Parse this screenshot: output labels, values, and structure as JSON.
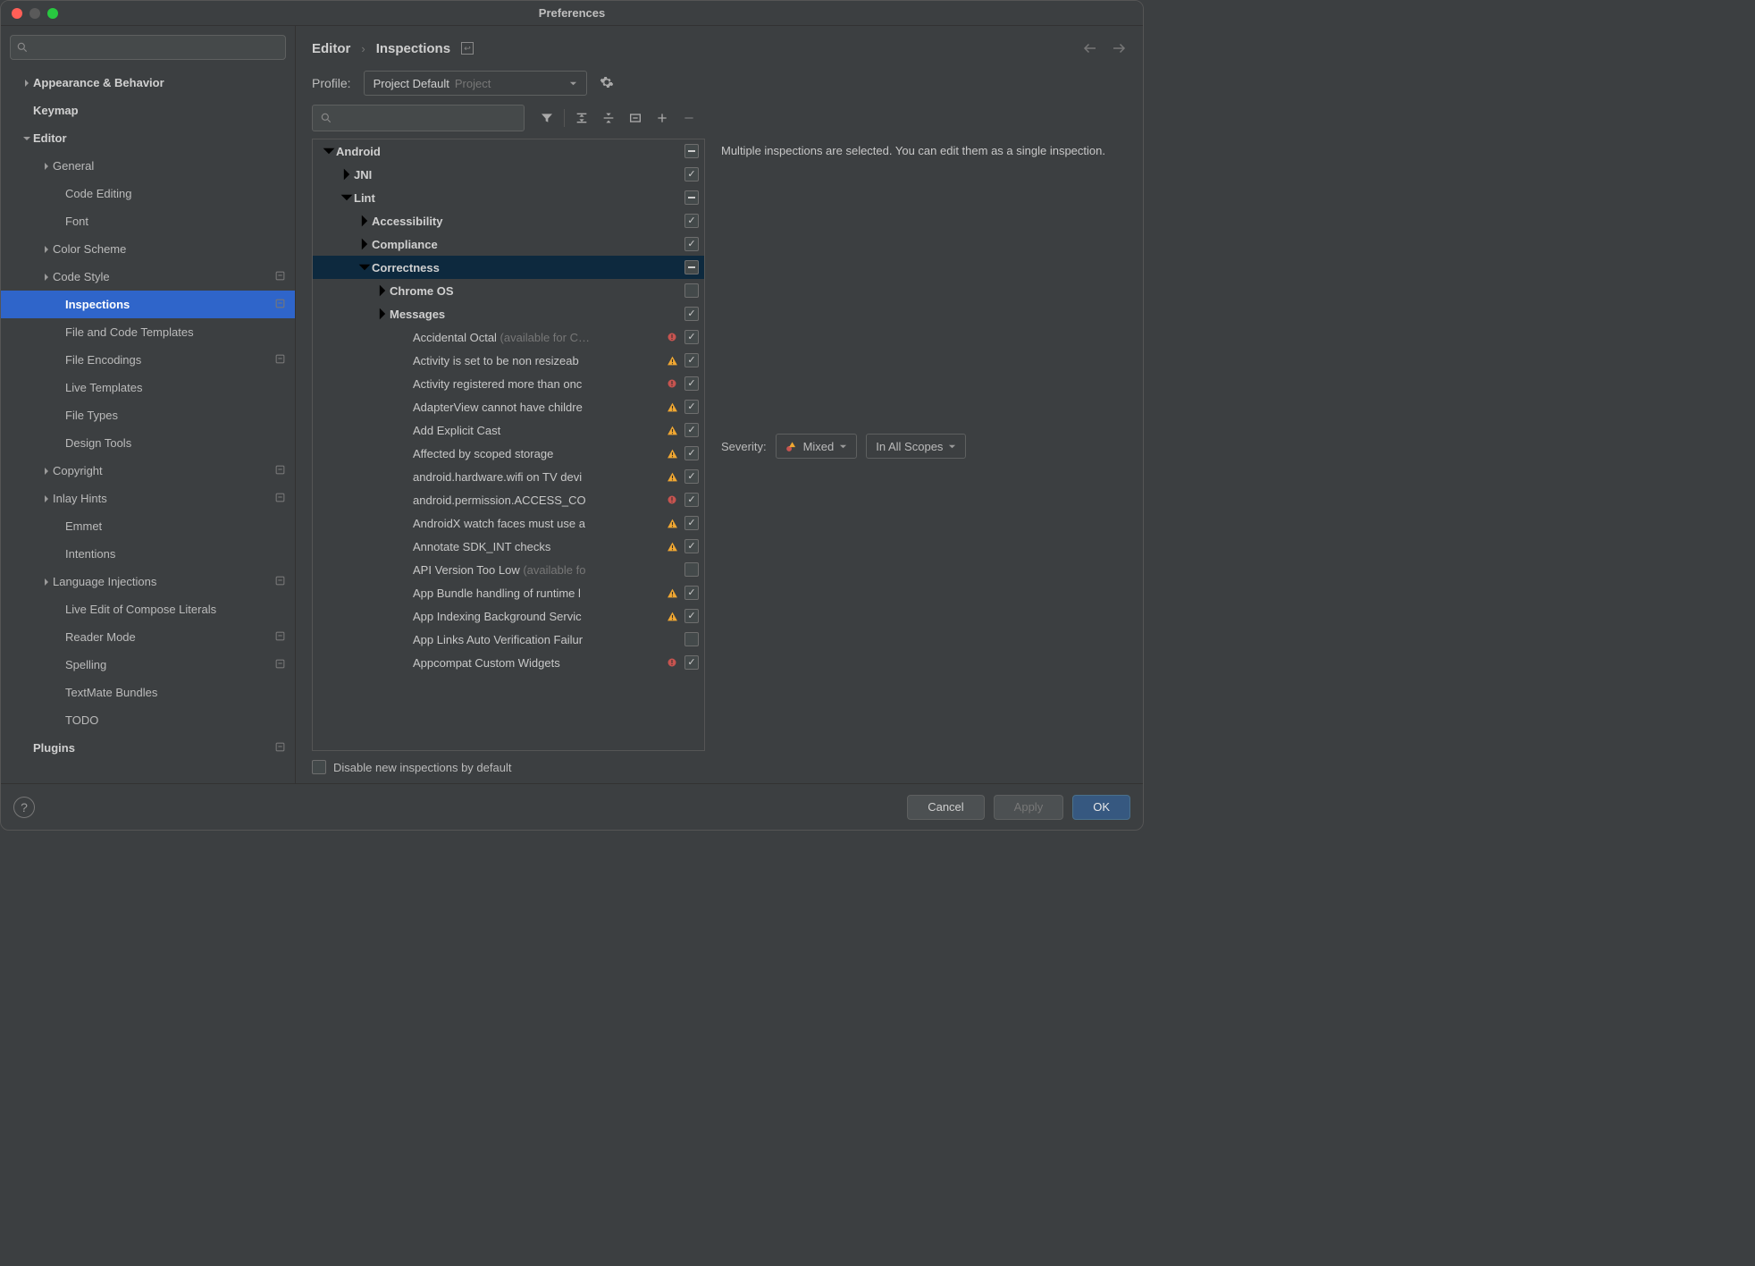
{
  "window_title": "Preferences",
  "sidebar": {
    "items": [
      {
        "label": "Appearance & Behavior",
        "depth": 0,
        "chevron": "right",
        "bold": true
      },
      {
        "label": "Keymap",
        "depth": 0,
        "bold": true
      },
      {
        "label": "Editor",
        "depth": 0,
        "chevron": "down",
        "bold": true
      },
      {
        "label": "General",
        "depth": 1,
        "chevron": "right"
      },
      {
        "label": "Code Editing",
        "depth": 2
      },
      {
        "label": "Font",
        "depth": 2
      },
      {
        "label": "Color Scheme",
        "depth": 1,
        "chevron": "right"
      },
      {
        "label": "Code Style",
        "depth": 1,
        "chevron": "right",
        "proj": true
      },
      {
        "label": "Inspections",
        "depth": 2,
        "selected": true,
        "proj": true
      },
      {
        "label": "File and Code Templates",
        "depth": 2
      },
      {
        "label": "File Encodings",
        "depth": 2,
        "proj": true
      },
      {
        "label": "Live Templates",
        "depth": 2
      },
      {
        "label": "File Types",
        "depth": 2
      },
      {
        "label": "Design Tools",
        "depth": 2
      },
      {
        "label": "Copyright",
        "depth": 1,
        "chevron": "right",
        "proj": true
      },
      {
        "label": "Inlay Hints",
        "depth": 1,
        "chevron": "right",
        "proj": true
      },
      {
        "label": "Emmet",
        "depth": 2
      },
      {
        "label": "Intentions",
        "depth": 2
      },
      {
        "label": "Language Injections",
        "depth": 1,
        "chevron": "right",
        "proj": true
      },
      {
        "label": "Live Edit of Compose Literals",
        "depth": 2
      },
      {
        "label": "Reader Mode",
        "depth": 2,
        "proj": true
      },
      {
        "label": "Spelling",
        "depth": 2,
        "proj": true
      },
      {
        "label": "TextMate Bundles",
        "depth": 2
      },
      {
        "label": "TODO",
        "depth": 2
      },
      {
        "label": "Plugins",
        "depth": 0,
        "bold": true,
        "proj": true
      }
    ]
  },
  "breadcrumb": {
    "root": "Editor",
    "leaf": "Inspections"
  },
  "profile": {
    "label": "Profile:",
    "value": "Project Default",
    "hint": "Project"
  },
  "inspections": {
    "tree": [
      {
        "label": "Android",
        "pad": 1,
        "chevron": "down",
        "bold": true,
        "check": "partial"
      },
      {
        "label": "JNI",
        "pad": 2,
        "chevron": "right",
        "bold": true,
        "check": "checked"
      },
      {
        "label": "Lint",
        "pad": 2,
        "chevron": "down",
        "bold": true,
        "check": "partial"
      },
      {
        "label": "Accessibility",
        "pad": 3,
        "chevron": "right",
        "bold": true,
        "check": "checked"
      },
      {
        "label": "Compliance",
        "pad": 3,
        "chevron": "right",
        "bold": true,
        "check": "checked"
      },
      {
        "label": "Correctness",
        "pad": 3,
        "chevron": "down",
        "bold": true,
        "check": "partial",
        "selected": true
      },
      {
        "label": "Chrome OS",
        "pad": 4,
        "chevron": "right",
        "bold": true,
        "check": "empty"
      },
      {
        "label": "Messages",
        "pad": 4,
        "chevron": "right",
        "bold": true,
        "check": "checked"
      },
      {
        "label": "Accidental Octal",
        "suffix": " (available for C…",
        "pad": 5,
        "check": "checked",
        "sev": "err"
      },
      {
        "label": "Activity is set to be non resizeab",
        "pad": 5,
        "check": "checked",
        "sev": "warn"
      },
      {
        "label": "Activity registered more than onc",
        "pad": 5,
        "check": "checked",
        "sev": "err"
      },
      {
        "label": "AdapterView cannot have childre",
        "pad": 5,
        "check": "checked",
        "sev": "warn"
      },
      {
        "label": "Add Explicit Cast",
        "pad": 5,
        "check": "checked",
        "sev": "warn"
      },
      {
        "label": "Affected by scoped storage",
        "pad": 5,
        "check": "checked",
        "sev": "warn"
      },
      {
        "label": "android.hardware.wifi on TV devi",
        "pad": 5,
        "check": "checked",
        "sev": "warn"
      },
      {
        "label": "android.permission.ACCESS_CO",
        "pad": 5,
        "check": "checked",
        "sev": "err"
      },
      {
        "label": "AndroidX watch faces must use a",
        "pad": 5,
        "check": "checked",
        "sev": "warn"
      },
      {
        "label": "Annotate SDK_INT checks",
        "pad": 5,
        "check": "checked",
        "sev": "warn"
      },
      {
        "label": "API Version Too Low",
        "suffix": " (available fo",
        "pad": 5,
        "check": "empty"
      },
      {
        "label": "App Bundle handling of runtime l",
        "pad": 5,
        "check": "checked",
        "sev": "warn"
      },
      {
        "label": "App Indexing Background Servic",
        "pad": 5,
        "check": "checked",
        "sev": "warn"
      },
      {
        "label": "App Links Auto Verification Failur",
        "pad": 5,
        "check": "empty"
      },
      {
        "label": "Appcompat Custom Widgets",
        "pad": 5,
        "check": "checked",
        "sev": "err"
      }
    ],
    "disable_label": "Disable new inspections by default"
  },
  "detail": {
    "message": "Multiple inspections are selected. You can edit them as a single inspection.",
    "severity_label": "Severity:",
    "severity_value": "Mixed",
    "scope_value": "In All Scopes"
  },
  "buttons": {
    "cancel": "Cancel",
    "apply": "Apply",
    "ok": "OK"
  }
}
